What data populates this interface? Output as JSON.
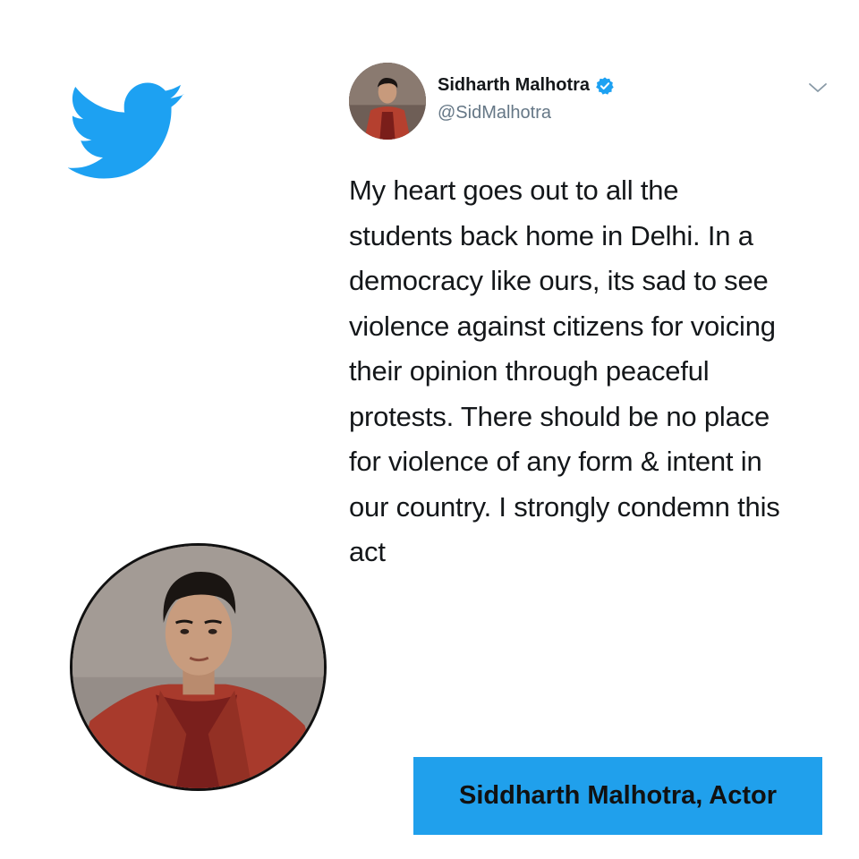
{
  "tweet": {
    "author": {
      "display_name": "Sidharth Malhotra",
      "handle": "@SidMalhotra",
      "verified": true
    },
    "text": "My heart goes out to all the\nstudents back home in Delhi. In a\ndemocracy like ours, its sad to see\nviolence against citizens for voicing\ntheir opinion through peaceful\nprotests. There should be no place\nfor violence of any form & intent in\nour country. I strongly condemn this\nact"
  },
  "caption": {
    "label": "Siddharth Malhotra, Actor"
  },
  "icons": {
    "logo": "twitter-bird-icon",
    "verified": "verified-badge-icon",
    "menu": "chevron-down-icon"
  },
  "colors": {
    "twitter_blue": "#1da1f2",
    "caption_bg": "#20a0ec",
    "handle_gray": "#657786"
  }
}
